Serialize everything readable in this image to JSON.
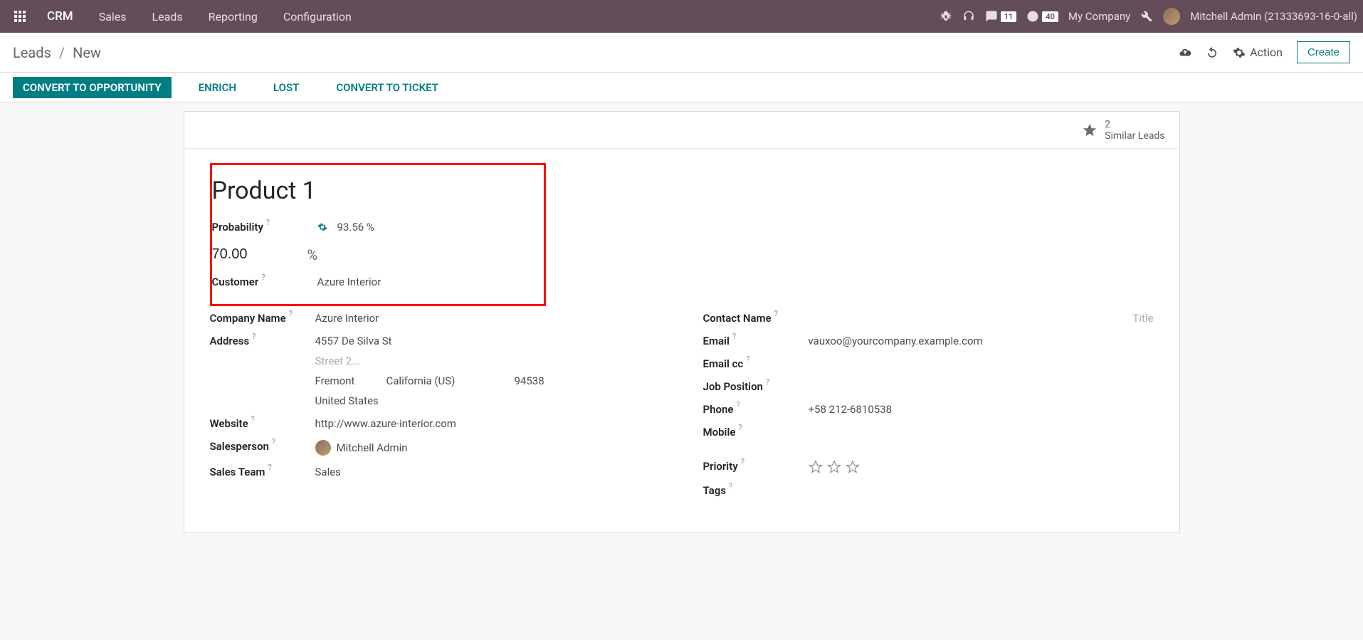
{
  "navbar": {
    "brand": "CRM",
    "items": [
      "Sales",
      "Leads",
      "Reporting",
      "Configuration"
    ],
    "msg_count": "11",
    "activity_count": "40",
    "company": "My Company",
    "user": "Mitchell Admin (21333693-16-0-all)"
  },
  "controlbar": {
    "bc_root": "Leads",
    "bc_current": "New",
    "action_label": "Action",
    "create_label": "Create"
  },
  "statusbar": {
    "convert_opp": "CONVERT TO OPPORTUNITY",
    "enrich": "ENRICH",
    "lost": "LOST",
    "convert_ticket": "CONVERT TO TICKET"
  },
  "similar": {
    "count": "2",
    "label": "Similar Leads"
  },
  "record": {
    "title": "Product 1",
    "probability_label": "Probability",
    "probability_auto": "93.56 %",
    "probability_value": "70.00",
    "pct": "%",
    "customer_label": "Customer",
    "customer_value": "Azure Interior",
    "company_label": "Company Name",
    "company_value": "Azure Interior",
    "address_label": "Address",
    "street": "4557 De Silva St",
    "street2_placeholder": "Street 2...",
    "city": "Fremont",
    "state": "California (US)",
    "zip": "94538",
    "country": "United States",
    "website_label": "Website",
    "website_value": "http://www.azure-interior.com",
    "salesperson_label": "Salesperson",
    "salesperson_value": "Mitchell Admin",
    "salesteam_label": "Sales Team",
    "salesteam_value": "Sales",
    "contact_label": "Contact Name",
    "title_placeholder": "Title",
    "email_label": "Email",
    "email_value": "vauxoo@yourcompany.example.com",
    "emailcc_label": "Email cc",
    "jobpos_label": "Job Position",
    "phone_label": "Phone",
    "phone_value": "+58 212-6810538",
    "mobile_label": "Mobile",
    "priority_label": "Priority",
    "tags_label": "Tags"
  }
}
